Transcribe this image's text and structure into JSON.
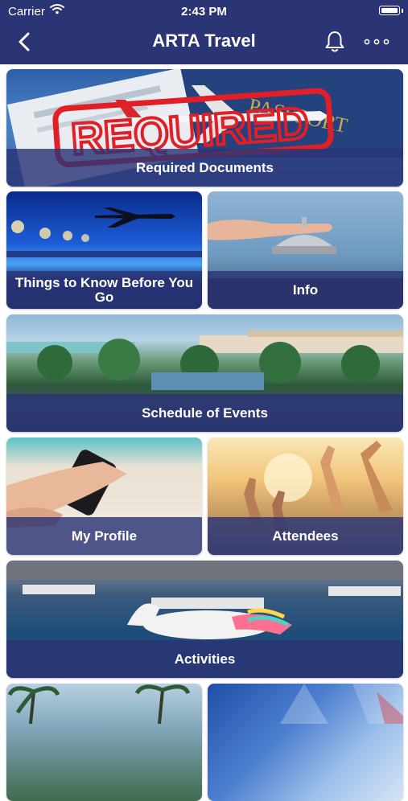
{
  "status_bar": {
    "carrier": "Carrier",
    "time": "2:43 PM"
  },
  "header": {
    "title": "ARTA Travel"
  },
  "icons": {
    "back": "chevron-left-icon",
    "notifications": "bell-icon",
    "more": "more-horizontal-icon"
  },
  "colors": {
    "brand": "#2b3475",
    "label_overlay": "rgba(43,52,117,0.82)"
  },
  "tiles": [
    {
      "label": "Required Documents"
    },
    {
      "label": "Things to Know Before You Go"
    },
    {
      "label": "Info"
    },
    {
      "label": "Schedule of Events"
    },
    {
      "label": "My Profile"
    },
    {
      "label": "Attendees"
    },
    {
      "label": "Activities"
    }
  ],
  "decor": {
    "stamp_text": "REQUIRED",
    "passport_text": "PASSPORT"
  }
}
